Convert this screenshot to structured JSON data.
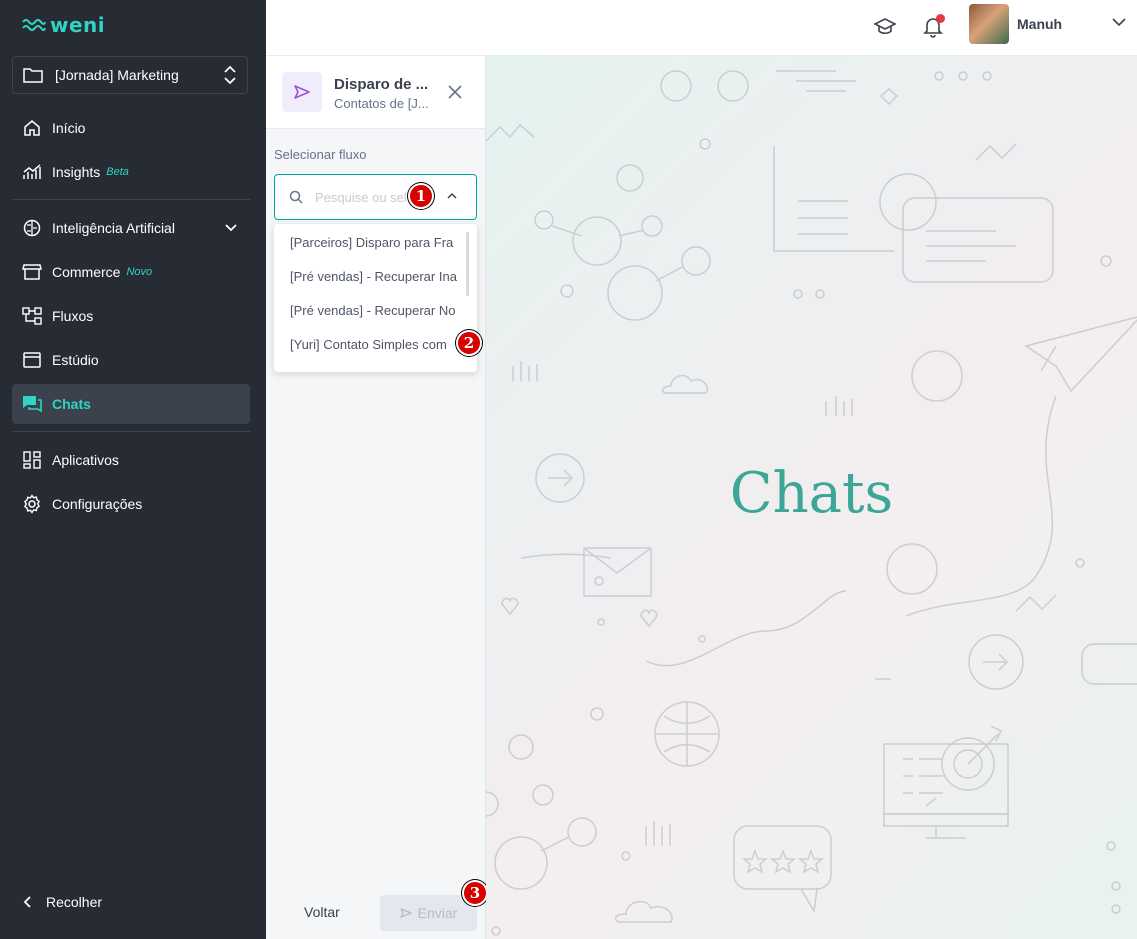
{
  "sidebar": {
    "logo": "weni",
    "project": "[Jornada] Marketing",
    "items": [
      {
        "label": "Início"
      },
      {
        "label": "Insights",
        "tag": "Beta"
      },
      {
        "label": "Inteligência Artificial"
      },
      {
        "label": "Commerce",
        "tag": "Novo"
      },
      {
        "label": "Fluxos"
      },
      {
        "label": "Estúdio"
      },
      {
        "label": "Chats"
      },
      {
        "label": "Aplicativos"
      },
      {
        "label": "Configurações"
      }
    ],
    "collapse": "Recolher"
  },
  "topbar": {
    "username": "Manuh"
  },
  "panel": {
    "title": "Disparo de ...",
    "subtitle": "Contatos de [J...",
    "field_label": "Selecionar fluxo",
    "search_placeholder": "Pesquise ou selecione",
    "options": [
      "[Parceiros] Disparo para Fra",
      "[Pré vendas] - Recuperar Ina",
      "[Pré vendas] - Recuperar No",
      "[Yuri] Contato Simples com"
    ],
    "back_label": "Voltar",
    "send_label": "Enviar"
  },
  "markers": [
    "1",
    "2",
    "3"
  ],
  "main": {
    "title": "Chats"
  },
  "colors": {
    "accent": "#2FD4C2",
    "sidebar_bg": "#272B33",
    "primary": "#00A49F",
    "marker": "#D90000",
    "title": "#3CA796"
  }
}
